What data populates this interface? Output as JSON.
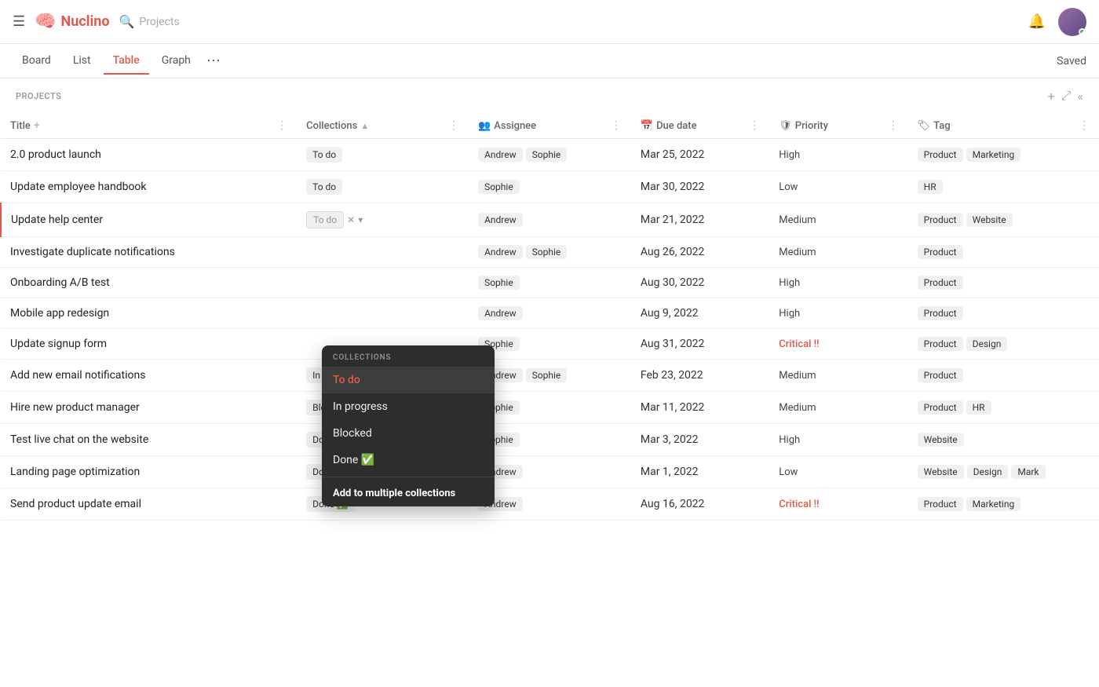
{
  "header": {
    "logo_text": "Nuclino",
    "search_placeholder": "Projects",
    "saved_label": "Saved"
  },
  "nav": {
    "tabs": [
      "Board",
      "List",
      "Table",
      "Graph"
    ],
    "active_tab": "Table",
    "more_label": "⋯"
  },
  "section": {
    "title": "PROJECTS",
    "add_icon": "+",
    "expand_icon": "⤢",
    "collapse_icon": "«"
  },
  "table": {
    "columns": [
      {
        "key": "title",
        "label": "Title",
        "icon": ""
      },
      {
        "key": "collections",
        "label": "Collections",
        "icon": ""
      },
      {
        "key": "assignee",
        "label": "Assignee",
        "icon": "👥"
      },
      {
        "key": "duedate",
        "label": "Due date",
        "icon": "📅"
      },
      {
        "key": "priority",
        "label": "Priority",
        "icon": "🛡"
      },
      {
        "key": "tag",
        "label": "Tag",
        "icon": "🏷"
      }
    ],
    "rows": [
      {
        "title": "2.0 product launch",
        "collection": "To do",
        "collection_editing": false,
        "assignees": [
          "Andrew",
          "Sophie"
        ],
        "due_date": "Mar 25, 2022",
        "priority": "High",
        "priority_critical": false,
        "tags": [
          "Product",
          "Marketing"
        ]
      },
      {
        "title": "Update employee handbook",
        "collection": "To do",
        "collection_editing": false,
        "assignees": [
          "Sophie"
        ],
        "due_date": "Mar 30, 2022",
        "priority": "Low",
        "priority_critical": false,
        "tags": [
          "HR"
        ]
      },
      {
        "title": "Update help center",
        "collection": "To do",
        "collection_editing": true,
        "assignees": [
          "Andrew"
        ],
        "due_date": "Mar 21, 2022",
        "priority": "Medium",
        "priority_critical": false,
        "tags": [
          "Product",
          "Website"
        ]
      },
      {
        "title": "Investigate duplicate notifications",
        "collection": "",
        "collection_editing": false,
        "assignees": [
          "Andrew",
          "Sophie"
        ],
        "due_date": "Aug 26, 2022",
        "priority": "Medium",
        "priority_critical": false,
        "tags": [
          "Product"
        ]
      },
      {
        "title": "Onboarding A/B test",
        "collection": "",
        "collection_editing": false,
        "assignees": [
          "Sophie"
        ],
        "due_date": "Aug 30, 2022",
        "priority": "High",
        "priority_critical": false,
        "tags": [
          "Product"
        ]
      },
      {
        "title": "Mobile app redesign",
        "collection": "",
        "collection_editing": false,
        "assignees": [
          "Andrew"
        ],
        "due_date": "Aug 9, 2022",
        "priority": "High",
        "priority_critical": false,
        "tags": [
          "Product"
        ]
      },
      {
        "title": "Update signup form",
        "collection": "",
        "collection_editing": false,
        "assignees": [
          "Sophie"
        ],
        "due_date": "Aug 31, 2022",
        "priority": "Critical",
        "priority_critical": true,
        "tags": [
          "Product",
          "Design"
        ]
      },
      {
        "title": "Add new email notifications",
        "collection": "In progress",
        "collection_editing": false,
        "assignees": [
          "Andrew",
          "Sophie"
        ],
        "due_date": "Feb 23, 2022",
        "priority": "Medium",
        "priority_critical": false,
        "tags": [
          "Product"
        ]
      },
      {
        "title": "Hire new product manager",
        "collection": "Blocked",
        "collection_editing": false,
        "assignees": [
          "Sophie"
        ],
        "due_date": "Mar 11, 2022",
        "priority": "Medium",
        "priority_critical": false,
        "tags": [
          "Product",
          "HR"
        ]
      },
      {
        "title": "Test live chat on the website",
        "collection": "Done ✅",
        "collection_editing": false,
        "assignees": [
          "Sophie"
        ],
        "due_date": "Mar 3, 2022",
        "priority": "High",
        "priority_critical": false,
        "tags": [
          "Website"
        ]
      },
      {
        "title": "Landing page optimization",
        "collection": "Done ✅",
        "collection_editing": false,
        "assignees": [
          "Andrew"
        ],
        "due_date": "Mar 1, 2022",
        "priority": "Low",
        "priority_critical": false,
        "tags": [
          "Website",
          "Design",
          "Mark"
        ]
      },
      {
        "title": "Send product update email",
        "collection": "Done ✅",
        "collection_editing": false,
        "assignees": [
          "Andrew"
        ],
        "due_date": "Aug 16, 2022",
        "priority": "Critical",
        "priority_critical": true,
        "tags": [
          "Product",
          "Marketing"
        ]
      }
    ]
  },
  "dropdown": {
    "header": "COLLECTIONS",
    "items": [
      {
        "label": "To do",
        "active": true
      },
      {
        "label": "In progress",
        "active": false
      },
      {
        "label": "Blocked",
        "active": false
      },
      {
        "label": "Done ✅",
        "active": false
      }
    ],
    "add_label": "Add to multiple collections"
  }
}
